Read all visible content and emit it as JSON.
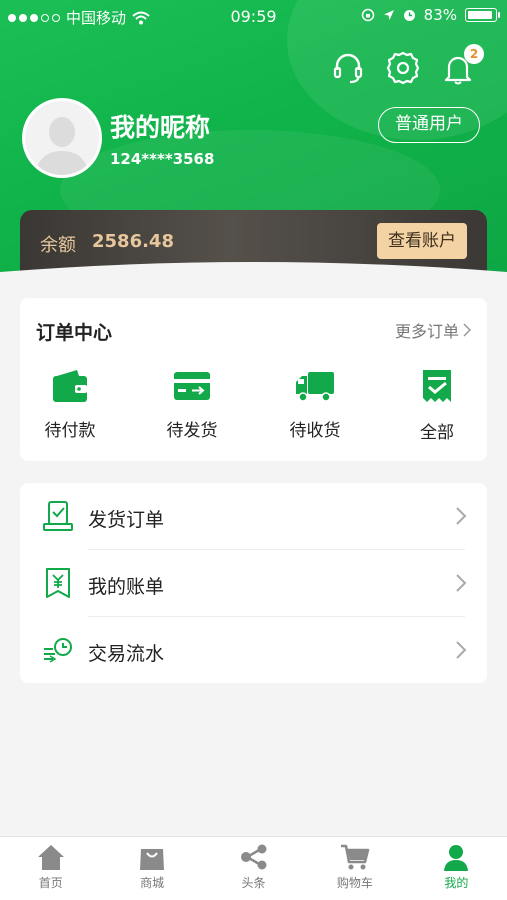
{
  "status_bar": {
    "carrier": "中国移动",
    "time": "09:59",
    "battery": "83%"
  },
  "header": {
    "notification_count": "2"
  },
  "profile": {
    "nickname": "我的昵称",
    "phone": "124****3568",
    "user_type": "普通用户"
  },
  "balance": {
    "label": "余额",
    "value": "2586.48",
    "view_button": "查看账户"
  },
  "orders": {
    "title": "订单中心",
    "more": "更多订单",
    "items": [
      {
        "label": "待付款",
        "icon": "wallet-icon"
      },
      {
        "label": "待发货",
        "icon": "shipping-card-icon"
      },
      {
        "label": "待收货",
        "icon": "truck-icon"
      },
      {
        "label": "全部",
        "icon": "checklist-icon"
      }
    ]
  },
  "menu": {
    "items": [
      {
        "label": "发货订单",
        "icon": "delivery-order-icon"
      },
      {
        "label": "我的账单",
        "icon": "bill-icon"
      },
      {
        "label": "交易流水",
        "icon": "transaction-flow-icon"
      }
    ]
  },
  "tabbar": {
    "items": [
      {
        "label": "首页",
        "icon": "home-icon"
      },
      {
        "label": "商城",
        "icon": "shopping-bag-icon"
      },
      {
        "label": "头条",
        "icon": "share-icon"
      },
      {
        "label": "购物车",
        "icon": "cart-icon"
      },
      {
        "label": "我的",
        "icon": "user-icon"
      }
    ],
    "active": "我的"
  },
  "colors": {
    "brand_green": "#12a94a",
    "balance_gold": "#e8c79c",
    "balance_bg": "#3a3734"
  }
}
